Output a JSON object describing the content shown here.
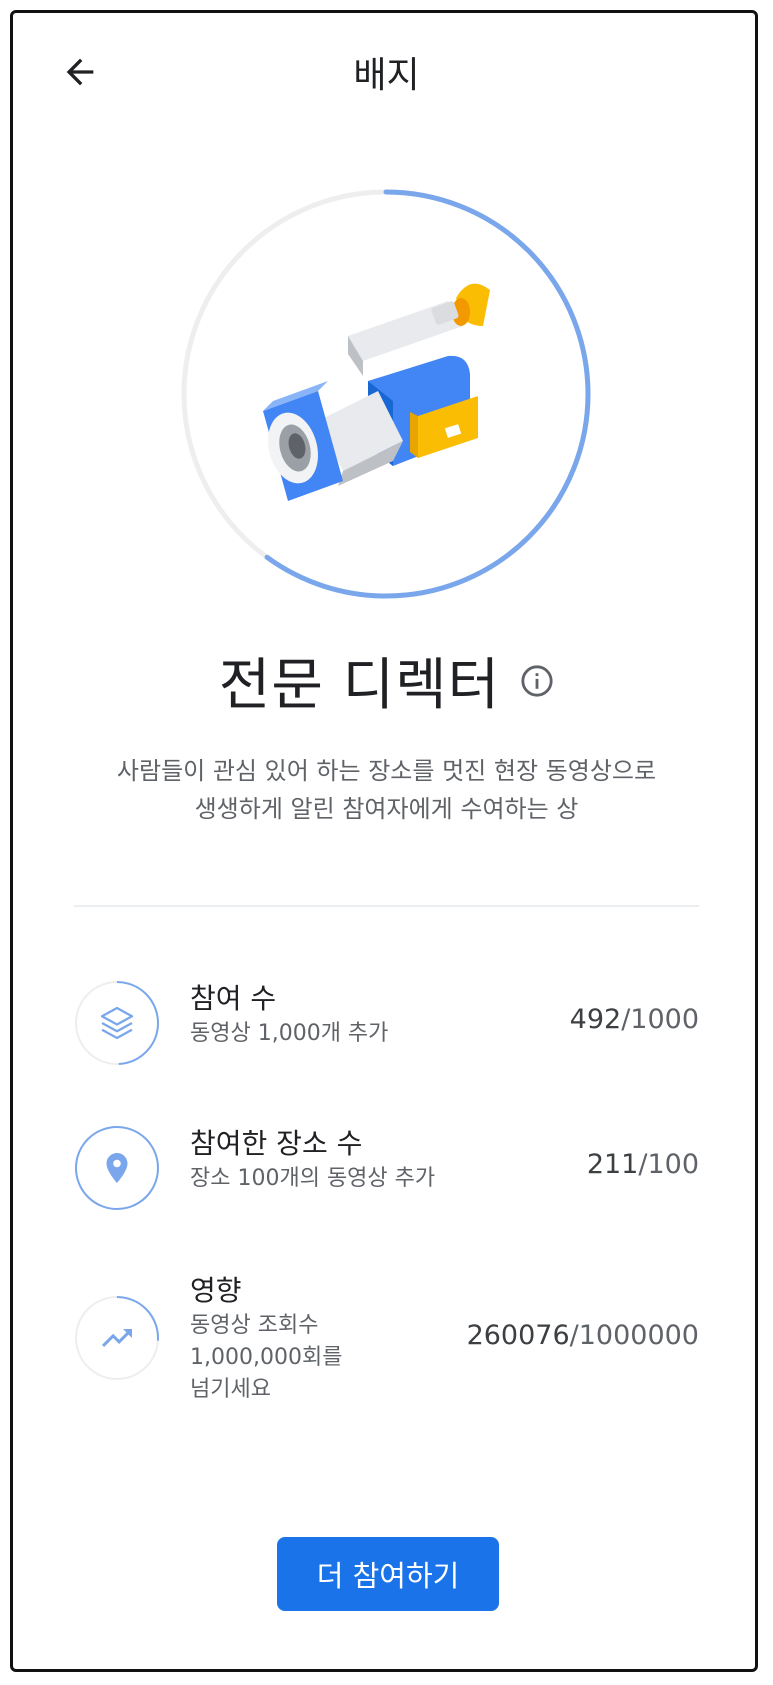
{
  "header": {
    "title": "배지",
    "back_icon": "arrow-left-icon"
  },
  "badge": {
    "name": "전문 디렉터",
    "progress_fraction": 0.6,
    "info_icon": "info-icon",
    "illustration": "video-camera-icon",
    "description_line1": "사람들이 관심 있어 하는 장소를 멋진 현장 동영상으로",
    "description_line2": "생생하게 알린 참여자에게 수여하는 상"
  },
  "metrics": [
    {
      "title": "참여 수",
      "subtitle": "동영상 1,000개 추가",
      "current": "492",
      "target": "/1000",
      "icon": "layers-icon",
      "progress": 0.492
    },
    {
      "title": "참여한 장소 수",
      "subtitle": "장소 100개의 동영상 추가",
      "current": "211",
      "target": "/100",
      "icon": "location-pin-icon",
      "progress": 1.0
    },
    {
      "title": "영향",
      "subtitle_line1": "동영상 조회수",
      "subtitle_line2": "1,000,000회를",
      "subtitle_line3": "넘기세요",
      "current": "260076",
      "target": "/1000000",
      "icon": "trending-up-icon",
      "progress": 0.26
    }
  ],
  "cta": {
    "label": "더 참여하기"
  },
  "colors": {
    "accent": "#1a73e8",
    "ring_blue": "#7aa7ec",
    "ring_gray": "#eeeeee"
  }
}
